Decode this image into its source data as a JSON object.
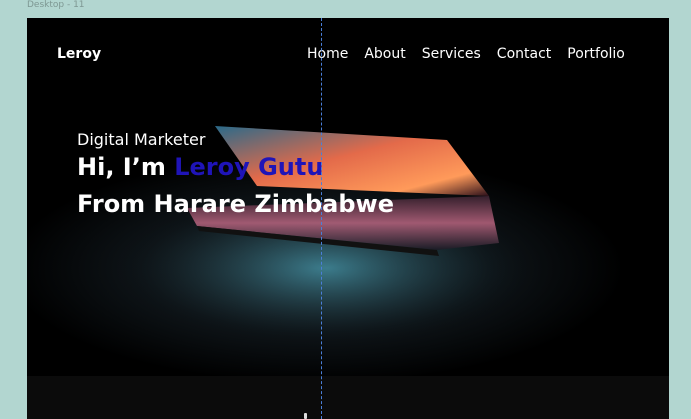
{
  "frame": {
    "label": "Desktop - 11"
  },
  "header": {
    "logo": "Leroy",
    "nav": [
      "Home",
      "About",
      "Services",
      "Contact",
      "Portfolio"
    ]
  },
  "hero": {
    "eyebrow": "Digital Marketer",
    "greeting": "Hi, I’m ",
    "name": "Leroy Gutu",
    "location_line": "From Harare Zimbabwe"
  },
  "colors": {
    "background": "#000000",
    "accent_name": "#1f14b8",
    "canvas": "#b2d6d0",
    "guide": "#4a7fd8"
  }
}
